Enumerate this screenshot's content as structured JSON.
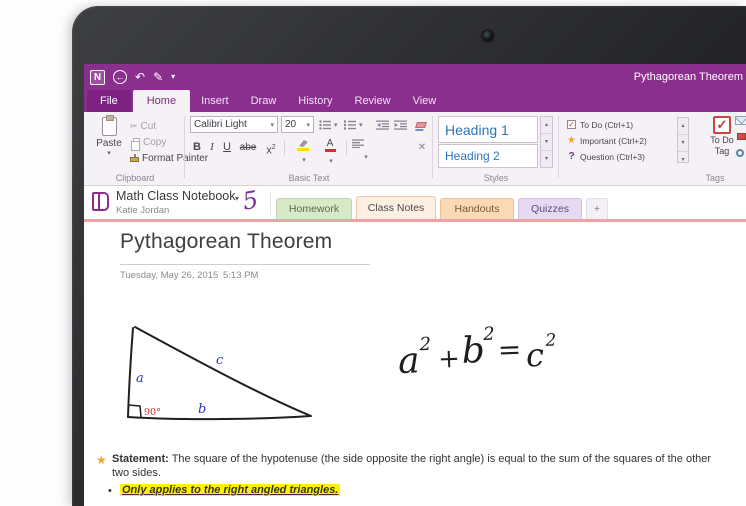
{
  "titlebar": {
    "title": "Pythagorean Theorem"
  },
  "icons": {
    "onenote_n": "N",
    "back": "←",
    "undo": "↶",
    "pen": "✎",
    "caret": "▾",
    "caret_up": "▴",
    "scissors": "✂",
    "x": "✕",
    "check": "✓",
    "star": "★",
    "question": "?",
    "more": "▾"
  },
  "ribbon": {
    "tabs": [
      {
        "label": "File"
      },
      {
        "label": "Home"
      },
      {
        "label": "Insert"
      },
      {
        "label": "Draw"
      },
      {
        "label": "History"
      },
      {
        "label": "Review"
      },
      {
        "label": "View"
      }
    ],
    "clipboard": {
      "group_label": "Clipboard",
      "paste": "Paste",
      "cut": "Cut",
      "copy": "Copy",
      "format_painter": "Format Painter"
    },
    "basic_text": {
      "group_label": "Basic Text",
      "font_name": "Calibri Light",
      "font_size": "20",
      "bold": "B",
      "italic": "I",
      "underline": "U",
      "strikethrough": "abe",
      "superscript_base": "x",
      "superscript_exp": "2",
      "font_color_letter": "A"
    },
    "styles": {
      "group_label": "Styles",
      "items": [
        {
          "label": "Heading 1"
        },
        {
          "label": "Heading 2"
        }
      ]
    },
    "tags": {
      "group_label": "Tags",
      "items": [
        {
          "label": "To Do (Ctrl+1)"
        },
        {
          "label": "Important (Ctrl+2)"
        },
        {
          "label": "Question (Ctrl+3)"
        }
      ],
      "todo_tag_line1": "To Do",
      "todo_tag_line2": "Tag"
    }
  },
  "navbar": {
    "notebook_name": "Math Class Notebook",
    "author": "Katie Jordan",
    "ink_number": "5"
  },
  "sections": [
    {
      "label": "Homework"
    },
    {
      "label": "Class Notes"
    },
    {
      "label": "Handouts"
    },
    {
      "label": "Quizzes"
    },
    {
      "label": "+"
    }
  ],
  "page": {
    "title": "Pythagorean Theorem",
    "date": "Tuesday, May 26, 2015",
    "time": "5:13 PM",
    "triangle": {
      "side_a": "a",
      "side_b": "b",
      "side_c": "c",
      "angle": "90°"
    },
    "equation": {
      "a": "a",
      "a_exp": "2",
      "plus": "+",
      "b": "b",
      "b_exp": "2",
      "equals": "=",
      "c": "c",
      "c_exp": "2"
    },
    "statement_label": "Statement:",
    "statement_text": "The square of the hypotenuse (the side opposite the right angle) is equal to the sum of the squares of the other two sides.",
    "bullet": "•",
    "bullet_text": "Only applies to the right angled triangles."
  },
  "colors": {
    "app_purple": "#8b2f8f",
    "section_line_salmon": "#f0a1a1",
    "heading_blue": "#2e74b5",
    "highlight_yellow": "#fff100",
    "ink_blue": "#2a35c8",
    "ink_red": "#d03030",
    "star_gold": "#efa431",
    "check_red": "#c0392b"
  }
}
